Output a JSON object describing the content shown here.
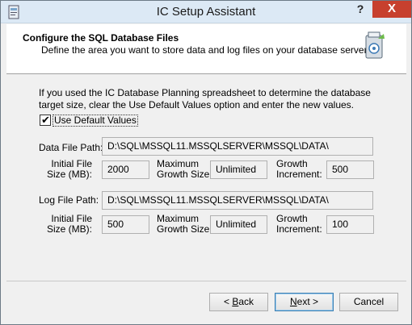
{
  "window": {
    "title": "IC Setup Assistant",
    "help_glyph": "?",
    "close_glyph": "X"
  },
  "header": {
    "title": "Configure the SQL Database Files",
    "subtitle": "Define the area you want to store data and log files on your database server."
  },
  "body": {
    "description": "If you used the IC Database Planning spreadsheet to determine the database target size, clear the Use Default Values option and enter the new values.",
    "use_default": {
      "label": "Use Default Values",
      "checked": true,
      "check_glyph": "✔"
    },
    "data": {
      "path_label": "Data File Path:",
      "path_value": "D:\\SQL\\MSSQL11.MSSQLSERVER\\MSSQL\\DATA\\",
      "initial_label_1": "Initial File",
      "initial_label_2": "Size (MB):",
      "initial_value": "2000",
      "max_label_1": "Maximum",
      "max_label_2": "Growth Size:",
      "max_value": "Unlimited",
      "inc_label_1": "Growth",
      "inc_label_2": "Increment:",
      "inc_value": "500"
    },
    "log": {
      "path_label": "Log File Path:",
      "path_value": "D:\\SQL\\MSSQL11.MSSQLSERVER\\MSSQL\\DATA\\",
      "initial_label_1": "Initial File",
      "initial_label_2": "Size (MB):",
      "initial_value": "500",
      "max_label_1": "Maximum",
      "max_label_2": "Growth Size:",
      "max_value": "Unlimited",
      "inc_label_1": "Growth",
      "inc_label_2": "Increment:",
      "inc_value": "100"
    }
  },
  "footer": {
    "back_prefix": "< ",
    "back_key": "B",
    "back_rest": "ack",
    "next_key": "N",
    "next_rest": "ext >",
    "cancel_label": "Cancel"
  },
  "colors": {
    "titlebar": "#dce9f5",
    "close_button": "#c7402e",
    "dialog_bg": "#f0f0f0"
  }
}
